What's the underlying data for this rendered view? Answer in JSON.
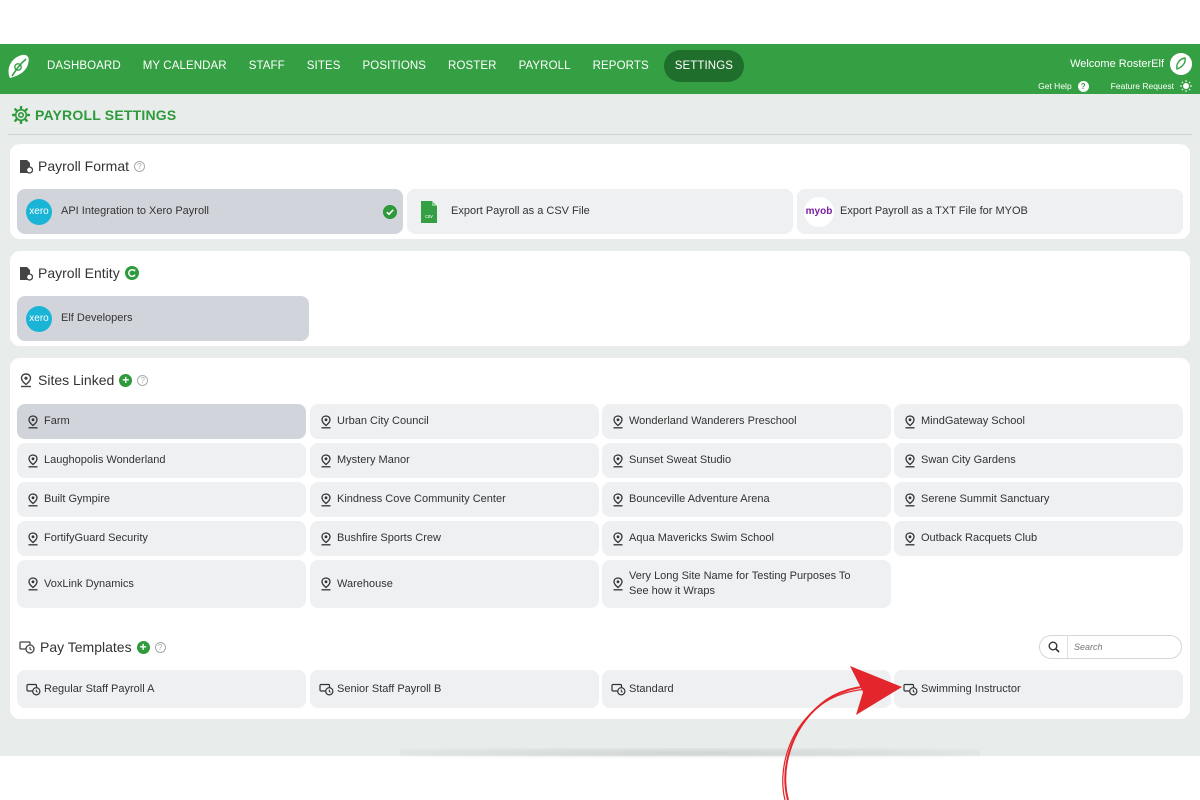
{
  "nav": {
    "items": [
      "DASHBOARD",
      "MY CALENDAR",
      "STAFF",
      "SITES",
      "POSITIONS",
      "ROSTER",
      "PAYROLL",
      "REPORTS",
      "SETTINGS"
    ],
    "active": "SETTINGS",
    "welcome": "Welcome RosterElf",
    "get_help": "Get Help",
    "feature_request": "Feature Request"
  },
  "page": {
    "title": "PAYROLL SETTINGS"
  },
  "payroll_format": {
    "title": "Payroll Format",
    "options": [
      {
        "label": "API Integration to Xero Payroll",
        "icon": "xero-logo",
        "badge": "xero",
        "selected": true
      },
      {
        "label": "Export Payroll as a CSV File",
        "icon": "csv-file-icon",
        "badge": "csv",
        "selected": false
      },
      {
        "label": "Export Payroll as a TXT File for MYOB",
        "icon": "myob-logo",
        "badge": "myob",
        "selected": false
      }
    ]
  },
  "payroll_entity": {
    "title": "Payroll Entity",
    "entity": {
      "label": "Elf Developers",
      "badge": "xero"
    }
  },
  "sites_linked": {
    "title": "Sites Linked",
    "sites": [
      "Farm",
      "Urban City Council",
      "Wonderland Wanderers Preschool",
      "MindGateway School",
      "Laughopolis Wonderland",
      "Mystery Manor",
      "Sunset Sweat Studio",
      "Swan City Gardens",
      "Built Gympire",
      "Kindness Cove Community Center",
      "Bounceville Adventure Arena",
      "Serene Summit Sanctuary",
      "FortifyGuard Security",
      "Bushfire Sports Crew",
      "Aqua Mavericks Swim School",
      "Outback Racquets Club",
      "VoxLink Dynamics",
      "Warehouse",
      "Very Long Site Name for Testing Purposes To See how it Wraps"
    ],
    "selected": "Farm"
  },
  "pay_templates": {
    "title": "Pay Templates",
    "search_placeholder": "Search",
    "templates": [
      "Regular Staff Payroll A",
      "Senior Staff Payroll B",
      "Standard",
      "Swimming Instructor"
    ]
  },
  "colors": {
    "brand_green": "#35a043",
    "active_nav": "#1f6e2b",
    "annotation_arrow": "#e3262b"
  }
}
